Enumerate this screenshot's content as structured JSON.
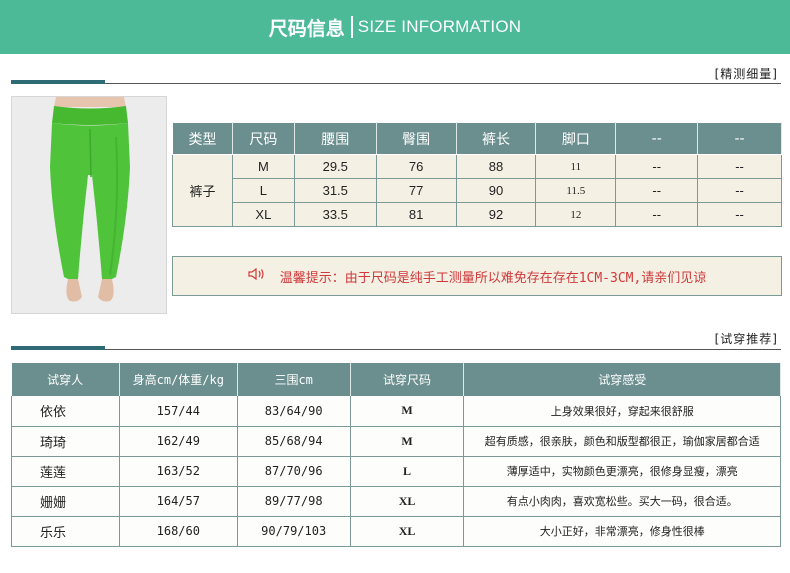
{
  "header": {
    "title_zh": "尺码信息",
    "title_en": "SIZE INFORMATION"
  },
  "section1": {
    "label": "[精测细量]"
  },
  "section2": {
    "label": "[试穿推荐]"
  },
  "size_table": {
    "headers": [
      "类型",
      "尺码",
      "腰围",
      "臀围",
      "裤长",
      "脚口",
      "--",
      "--"
    ],
    "type": "裤子",
    "rows": [
      {
        "size": "M",
        "waist": "29.5",
        "hip": "76",
        "length": "88",
        "hem": "11",
        "c7": "--",
        "c8": "--"
      },
      {
        "size": "L",
        "waist": "31.5",
        "hip": "77",
        "length": "90",
        "hem": "11.5",
        "c7": "--",
        "c8": "--"
      },
      {
        "size": "XL",
        "waist": "33.5",
        "hip": "81",
        "length": "92",
        "hem": "12",
        "c7": "--",
        "c8": "--"
      }
    ]
  },
  "notice": {
    "text": "温馨提示：由于尺码是纯手工测量所以难免存在存在1CM-3CM,请亲们见谅"
  },
  "try_table": {
    "headers": [
      "试穿人",
      "身高cm/体重/kg",
      "三围cm",
      "试穿尺码",
      "试穿感受"
    ],
    "rows": [
      {
        "name": "依依",
        "hw": "157/44",
        "bust": "83/64/90",
        "size": "M",
        "feel": "上身效果很好，穿起来很舒服"
      },
      {
        "name": "琦琦",
        "hw": "162/49",
        "bust": "85/68/94",
        "size": "M",
        "feel": "超有质感，很亲肤，颜色和版型都很正，瑜伽家居都合适"
      },
      {
        "name": "莲莲",
        "hw": "163/52",
        "bust": "87/70/96",
        "size": "L",
        "feel": "薄厚适中，实物颜色更漂亮，很修身显瘦，漂亮"
      },
      {
        "name": "姗姗",
        "hw": "164/57",
        "bust": "89/77/98",
        "size": "XL",
        "feel": "有点小肉肉，喜欢宽松些。买大一码，很合适。"
      },
      {
        "name": "乐乐",
        "hw": "168/60",
        "bust": "90/79/103",
        "size": "XL",
        "feel": "大小正好，非常漂亮，修身性很棒"
      }
    ]
  },
  "colors": {
    "header_bg": "#4cba97",
    "table_header": "#6b8f8e",
    "accent_line": "#2e6b74",
    "notice_text": "#d0383a",
    "pants_green": "#4fc43a"
  }
}
